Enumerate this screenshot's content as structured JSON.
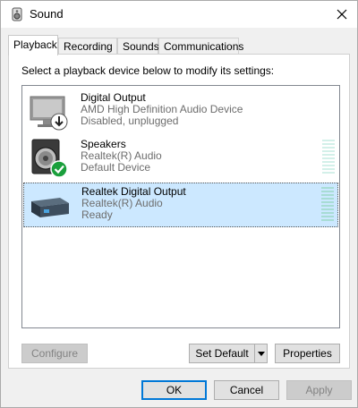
{
  "window": {
    "title": "Sound"
  },
  "tabs": [
    {
      "label": "Playback",
      "active": true
    },
    {
      "label": "Recording"
    },
    {
      "label": "Sounds"
    },
    {
      "label": "Communications"
    }
  ],
  "instruction": "Select a playback device below to modify its settings:",
  "devices": [
    {
      "name": "Digital Output",
      "driver": "AMD High Definition Audio Device",
      "status": "Disabled, unplugged",
      "icon": "monitor-icon",
      "badge": "unplugged-arrow-badge",
      "selected": false
    },
    {
      "name": "Speakers",
      "driver": "Realtek(R) Audio",
      "status": "Default Device",
      "icon": "speaker-icon",
      "badge": "default-check-badge",
      "selected": false
    },
    {
      "name": "Realtek Digital Output",
      "driver": "Realtek(R) Audio",
      "status": "Ready",
      "icon": "digital-output-device-icon",
      "selected": true
    }
  ],
  "buttons": {
    "configure": "Configure",
    "set_default": "Set Default",
    "properties": "Properties",
    "ok": "OK",
    "cancel": "Cancel",
    "apply": "Apply"
  },
  "colors": {
    "accent": "#0078d7",
    "selection": "#cce8ff",
    "check_green": "#1a9f3c"
  }
}
